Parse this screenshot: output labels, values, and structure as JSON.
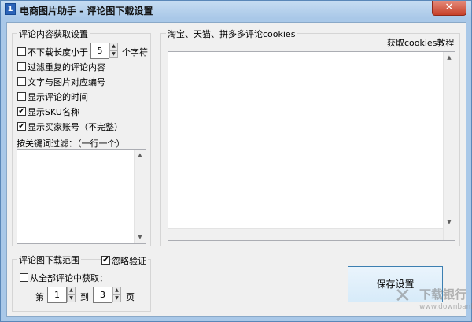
{
  "window": {
    "title": "电商图片助手 - 评论图下载设置",
    "icon_glyph": "1",
    "close_glyph": "✕"
  },
  "content_settings": {
    "title": "评论内容获取设置",
    "min_length": {
      "label": "不下载长度小于：",
      "value": "5",
      "unit": "个字符",
      "checked": false
    },
    "options": [
      {
        "label": "过滤重复的评论内容",
        "checked": false
      },
      {
        "label": "文字与图片对应编号",
        "checked": false
      },
      {
        "label": "显示评论的时间",
        "checked": false
      },
      {
        "label": "显示SKU名称",
        "checked": true
      },
      {
        "label": "显示买家账号（不完整）",
        "checked": true
      }
    ],
    "keyword_filter_label": "按关键词过滤：（一行一个）"
  },
  "cookies": {
    "title": "淘宝、天猫、拼多多评论cookies",
    "tutorial_link": "获取cookies教程"
  },
  "download_range": {
    "title": "评论图下载范围",
    "ignore_verify": {
      "label": "忽略验证",
      "checked": true
    },
    "from_all": {
      "label": "从全部评论中获取：",
      "checked": false
    },
    "page_prefix": "第",
    "page_from": "1",
    "page_to_label": "到",
    "page_to": "3",
    "page_suffix": "页"
  },
  "save_button": "保存设置",
  "watermark": {
    "text": "下载银行",
    "url": "www.downbank.cn"
  },
  "check_glyph": "✔"
}
